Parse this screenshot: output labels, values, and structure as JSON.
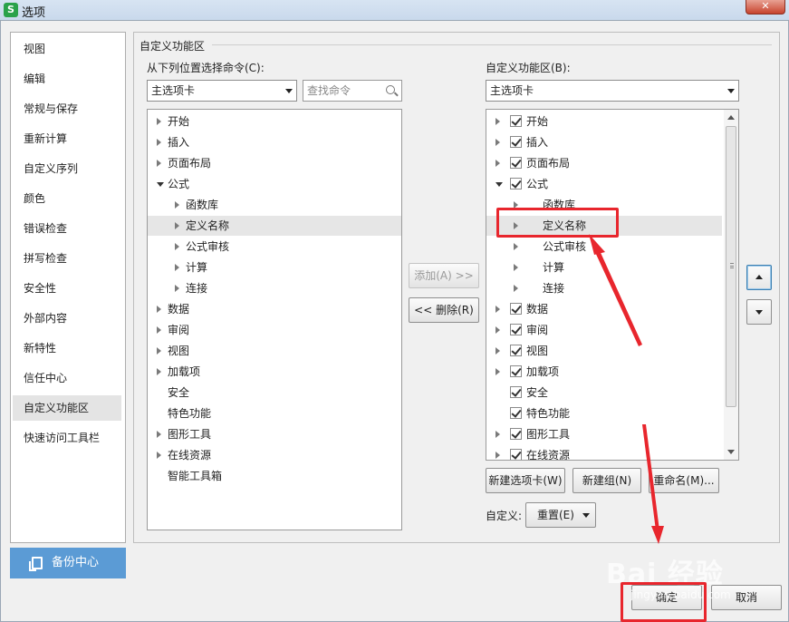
{
  "window": {
    "title": "选项",
    "app_icon": "S"
  },
  "sidebar": {
    "items": [
      {
        "label": "视图"
      },
      {
        "label": "编辑"
      },
      {
        "label": "常规与保存"
      },
      {
        "label": "重新计算"
      },
      {
        "label": "自定义序列"
      },
      {
        "label": "颜色"
      },
      {
        "label": "错误检查"
      },
      {
        "label": "拼写检查"
      },
      {
        "label": "安全性"
      },
      {
        "label": "外部内容"
      },
      {
        "label": "新特性"
      },
      {
        "label": "信任中心"
      },
      {
        "label": "自定义功能区"
      },
      {
        "label": "快速访问工具栏"
      }
    ],
    "active_index": 12,
    "backup_label": "备份中心"
  },
  "panel": {
    "group_title": "自定义功能区",
    "left": {
      "label": "从下列位置选择命令(C):",
      "combo_value": "主选项卡",
      "search_placeholder": "查找命令",
      "items": [
        {
          "label": "开始",
          "level": 0,
          "expand": "collapsed"
        },
        {
          "label": "插入",
          "level": 0,
          "expand": "collapsed"
        },
        {
          "label": "页面布局",
          "level": 0,
          "expand": "collapsed"
        },
        {
          "label": "公式",
          "level": 0,
          "expand": "expanded"
        },
        {
          "label": "函数库",
          "level": 1,
          "expand": "collapsed"
        },
        {
          "label": "定义名称",
          "level": 1,
          "expand": "collapsed",
          "selected": true
        },
        {
          "label": "公式审核",
          "level": 1,
          "expand": "collapsed"
        },
        {
          "label": "计算",
          "level": 1,
          "expand": "collapsed"
        },
        {
          "label": "连接",
          "level": 1,
          "expand": "collapsed"
        },
        {
          "label": "数据",
          "level": 0,
          "expand": "collapsed"
        },
        {
          "label": "审阅",
          "level": 0,
          "expand": "collapsed"
        },
        {
          "label": "视图",
          "level": 0,
          "expand": "collapsed"
        },
        {
          "label": "加载项",
          "level": 0,
          "expand": "collapsed"
        },
        {
          "label": "安全",
          "level": 0,
          "expand": "none"
        },
        {
          "label": "特色功能",
          "level": 0,
          "expand": "none"
        },
        {
          "label": "图形工具",
          "level": 0,
          "expand": "collapsed"
        },
        {
          "label": "在线资源",
          "level": 0,
          "expand": "collapsed"
        },
        {
          "label": "智能工具箱",
          "level": 0,
          "expand": "none"
        }
      ]
    },
    "add_button": "添加(A) >>",
    "remove_button": "<< 删除(R)",
    "right": {
      "label": "自定义功能区(B):",
      "combo_value": "主选项卡",
      "items": [
        {
          "label": "开始",
          "level": 0,
          "expand": "collapsed",
          "checked": true
        },
        {
          "label": "插入",
          "level": 0,
          "expand": "collapsed",
          "checked": true
        },
        {
          "label": "页面布局",
          "level": 0,
          "expand": "collapsed",
          "checked": true
        },
        {
          "label": "公式",
          "level": 0,
          "expand": "expanded",
          "checked": true
        },
        {
          "label": "函数库",
          "level": 1,
          "expand": "collapsed"
        },
        {
          "label": "定义名称",
          "level": 1,
          "expand": "collapsed",
          "selected": true
        },
        {
          "label": "公式审核",
          "level": 1,
          "expand": "collapsed"
        },
        {
          "label": "计算",
          "level": 1,
          "expand": "collapsed"
        },
        {
          "label": "连接",
          "level": 1,
          "expand": "collapsed"
        },
        {
          "label": "数据",
          "level": 0,
          "expand": "collapsed",
          "checked": true
        },
        {
          "label": "审阅",
          "level": 0,
          "expand": "collapsed",
          "checked": true
        },
        {
          "label": "视图",
          "level": 0,
          "expand": "collapsed",
          "checked": true
        },
        {
          "label": "加载项",
          "level": 0,
          "expand": "collapsed",
          "checked": true
        },
        {
          "label": "安全",
          "level": 0,
          "expand": "none",
          "checked": true
        },
        {
          "label": "特色功能",
          "level": 0,
          "expand": "none",
          "checked": true
        },
        {
          "label": "图形工具",
          "level": 0,
          "expand": "collapsed",
          "checked": true
        },
        {
          "label": "在线资源",
          "level": 0,
          "expand": "collapsed",
          "checked": true
        }
      ]
    },
    "new_tab_button": "新建选项卡(W)",
    "new_group_button": "新建组(N)",
    "rename_button": "重命名(M)...",
    "customize_label": "自定义:",
    "reset_button": "重置(E)"
  },
  "footer": {
    "ok_button": "确定",
    "cancel_button": "取消"
  },
  "watermark": {
    "brand": "Bai 经验",
    "url": "jingyan.baidu.com"
  },
  "colors": {
    "annotation_red": "#e8262d",
    "backup_blue": "#5b9bd5"
  }
}
